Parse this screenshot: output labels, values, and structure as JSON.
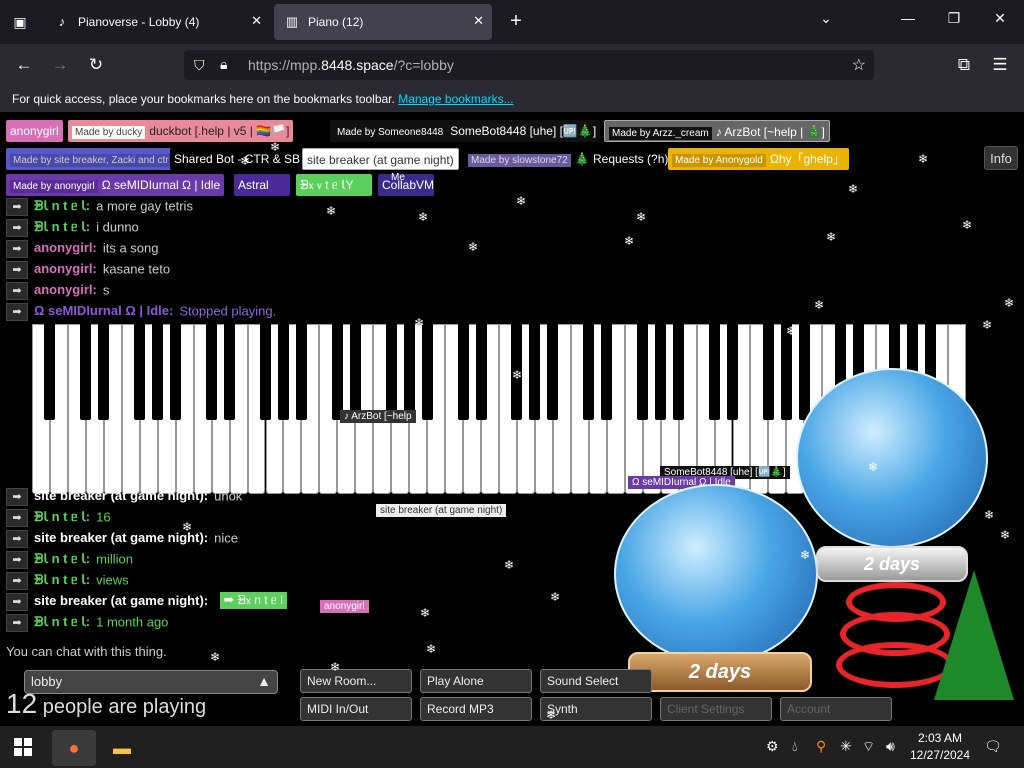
{
  "browser": {
    "tabs": [
      {
        "title": "Pianoverse - Lobby (4)",
        "active": false
      },
      {
        "title": "Piano (12)",
        "active": true
      }
    ],
    "url_prefix": "https://mpp.",
    "url_domain": "8448.space",
    "url_suffix": "/?c=lobby",
    "bookmarks_text": "For quick access, place your bookmarks here on the bookmarks toolbar.",
    "bookmarks_link": "Manage bookmarks..."
  },
  "users": [
    {
      "tag": "",
      "name": "anonygirl",
      "color": "#d870b8"
    },
    {
      "tag": "Made by ducky",
      "name": "duckbot [.help | v5 | 🏳️‍🌈🏳️]",
      "color": "#e88a9a"
    },
    {
      "tag": "Made by Someone8448",
      "name": "SomeBot8448 [uhe] [🆙🎄]",
      "color": "#111111"
    },
    {
      "tag": "Made by Arzz._cream",
      "name": "♪ ArzBot [~help | 🎄]",
      "color": "#666666"
    },
    {
      "tag": "Made by site breaker, Zacki and ctr",
      "name": "Shared Bot - CTR & SB",
      "color": "#5858c8"
    },
    {
      "tag": "",
      "name": "site breaker (at game night)",
      "color": "#ffffff"
    },
    {
      "tag": "Made by slowstone72",
      "name": "🎄 Requests (?h)",
      "color": "#6a5aa0"
    },
    {
      "tag": "Made by Anonygold",
      "name": "Ωhy「ghelp」",
      "color": "#e8b400"
    },
    {
      "tag": "Made by anonygirl",
      "name": "Ω seMIDIurnal Ω | Idle",
      "color": "#6a3aa8"
    },
    {
      "tag": "",
      "name": "Astral",
      "color": "#4a2a9a"
    },
    {
      "tag": "",
      "name": "ᗾ᥊ ᥎ t ᥱ ꙆY",
      "color": "#5cd05c"
    },
    {
      "tag": "Me",
      "name": "CollabVM",
      "color": "#3a2a8a"
    }
  ],
  "info_label": "Info",
  "chat_top": [
    {
      "name": "ᗾꙆ n t ᥱ Ꙇ:",
      "text": "a more gay tetris",
      "color": "#5cd05c"
    },
    {
      "name": "ᗾꙆ n t ᥱ Ꙇ:",
      "text": "i dunno",
      "color": "#5cd05c"
    },
    {
      "name": "anonygirl:",
      "text": "its a song",
      "color": "#d870b8"
    },
    {
      "name": "anonygirl:",
      "text": "kasane teto",
      "color": "#d870b8"
    },
    {
      "name": "anonygirl:",
      "text": "s",
      "color": "#d870b8"
    },
    {
      "name": "Ω seMIDIurnal Ω | Idle:",
      "text": "Stopped playing.",
      "color": "#6a3aa8"
    }
  ],
  "chat_bottom": [
    {
      "name": "site breaker (at game night):",
      "text": "unok",
      "color": "#ffffff"
    },
    {
      "name": "ᗾꙆ n t ᥱ Ꙇ:",
      "text": "16",
      "color": "#5cd05c"
    },
    {
      "name": "site breaker (at game night):",
      "text": "nice",
      "color": "#ffffff"
    },
    {
      "name": "ᗾꙆ n t ᥱ Ꙇ:",
      "text": "million",
      "color": "#5cd05c"
    },
    {
      "name": "ᗾꙆ n t ᥱ Ꙇ:",
      "text": "views",
      "color": "#5cd05c"
    },
    {
      "name": "site breaker (at game night):",
      "text": "",
      "color": "#ffffff"
    },
    {
      "name": "ᗾꙆ n t ᥱ Ꙇ:",
      "text": "1 month ago",
      "color": "#5cd05c"
    }
  ],
  "cursor_labels": {
    "arzbot": "♪ ArzBot [~help",
    "somebot": "SomeBot8448 [uhe] [🆙🎄]",
    "semidi": "Ω seMIDIurnal Ω | Idle",
    "sitebreaker": "site breaker (at game night)",
    "anonygirl": "anonygirl",
    "intel": "➡ ᗾ᥊ n t ᥱ l"
  },
  "status_text": "You can chat with this thing.",
  "room": "lobby",
  "people": {
    "count": "12",
    "text": "people are playing"
  },
  "controls": {
    "new_room": "New Room...",
    "play_alone": "Play Alone",
    "sound_select": "Sound Select",
    "midi": "MIDI In/Out",
    "record": "Record MP3",
    "synth": "Synth",
    "client_settings": "Client Settings",
    "account": "Account"
  },
  "globes": {
    "label1": "2 days",
    "label2": "2 days"
  },
  "taskbar": {
    "time": "2:03 AM",
    "date": "12/27/2024"
  }
}
